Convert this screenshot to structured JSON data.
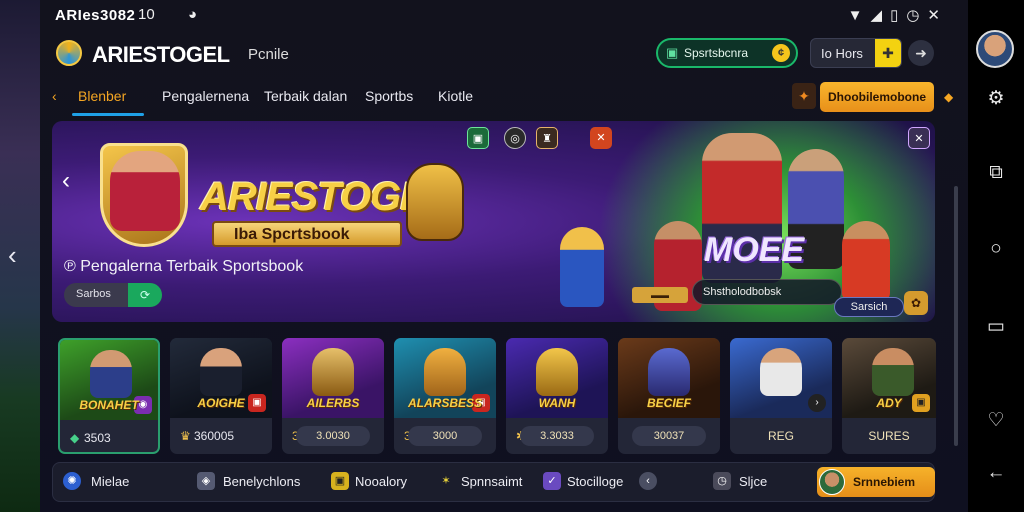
{
  "status": {
    "time": "ARIes3082",
    "extra": "10",
    "circle_icon": "clock-icon",
    "right_icons": [
      "wifi-icon",
      "signal-icon",
      "battery-icon",
      "alarm-icon",
      "close-icon"
    ]
  },
  "header": {
    "brand": "ARIESTOGEL",
    "profile_link": "Pcnile",
    "sport_pill": "Spsrtsbcnra",
    "hours_label": "Io Hors"
  },
  "tabs": {
    "items": [
      "Blenber",
      "Pengalernena",
      "Terbaik dalan",
      "Sportbs",
      "Kiotle"
    ],
    "active_index": 0,
    "promo_label": "Dhoobilemobone"
  },
  "banner": {
    "title": "ARIESTOGEL",
    "subtitle": "Iba Spcrtsbook",
    "tagline": "Pengalerna Terbaik Sportsbook",
    "pill_label": "Sarbos",
    "medal_text": "MOEE",
    "info_text": "Shstholodbobsk",
    "search_label": "Sarsich"
  },
  "cards": [
    {
      "name": "BONAHET",
      "value": "3503",
      "icon": "gem-icon"
    },
    {
      "name": "AOIGHE",
      "value": "360005",
      "icon": "trophy-icon"
    },
    {
      "name": "AILERBS",
      "value": "3.0030",
      "icon": "coin-icon"
    },
    {
      "name": "ALARSBESS",
      "value": "3000",
      "icon": "coin-icon"
    },
    {
      "name": "WANH",
      "value": "3.3033",
      "icon": "star-icon"
    },
    {
      "name": "BECIEF",
      "value": "30037",
      "icon": "none"
    },
    {
      "name": "",
      "value": "REG",
      "icon": "none"
    },
    {
      "name": "ADY",
      "value": "SURES",
      "icon": "none"
    }
  ],
  "bottom": {
    "items": [
      "Mielae",
      "Benelychlons",
      "Nooalory",
      "Spnnsaimt",
      "Stocilloge",
      "Sljce"
    ],
    "cta": "Srnnebiem"
  },
  "colors": {
    "accent": "#f5a623",
    "green": "#1ab86a",
    "tab_underline": "#1fa1e8"
  }
}
